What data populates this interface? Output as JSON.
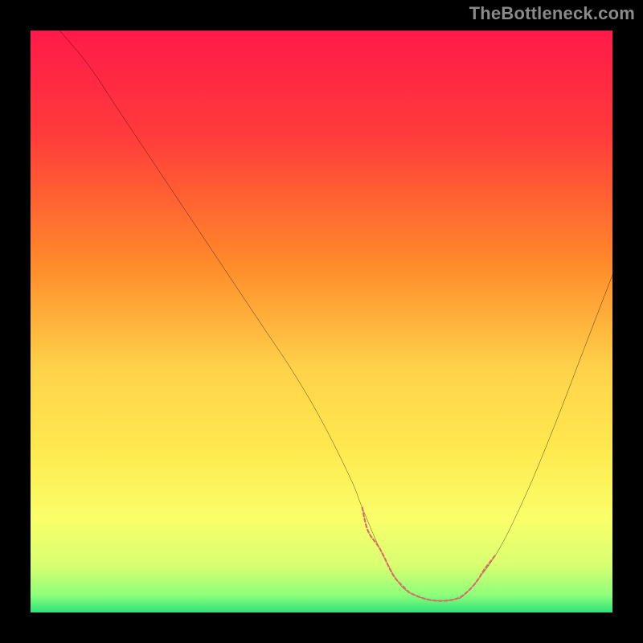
{
  "attribution": "TheBottleneck.com",
  "chart_data": {
    "type": "line",
    "title": "",
    "xlabel": "",
    "ylabel": "",
    "xlim": [
      0,
      100
    ],
    "ylim": [
      0,
      100
    ],
    "gradient_stops": [
      {
        "offset": 0,
        "color": "#ff1a49"
      },
      {
        "offset": 18,
        "color": "#ff3b3b"
      },
      {
        "offset": 40,
        "color": "#ff8a2a"
      },
      {
        "offset": 58,
        "color": "#ffd24a"
      },
      {
        "offset": 72,
        "color": "#ffe94f"
      },
      {
        "offset": 84,
        "color": "#faff6a"
      },
      {
        "offset": 92,
        "color": "#d7ff70"
      },
      {
        "offset": 97,
        "color": "#8dff7a"
      },
      {
        "offset": 100,
        "color": "#2fe27a"
      }
    ],
    "series": [
      {
        "name": "curve",
        "x": [
          5,
          10,
          15,
          20,
          25,
          30,
          35,
          40,
          45,
          50,
          55,
          57,
          60,
          63,
          65,
          68,
          70,
          73,
          75,
          80,
          85,
          90,
          95,
          100
        ],
        "values": [
          100,
          94,
          86.5,
          79,
          71.5,
          64,
          56.5,
          49,
          41.5,
          33,
          23,
          18,
          11,
          5.5,
          3.5,
          2.3,
          2.0,
          2.3,
          3.5,
          10,
          20,
          32,
          45,
          58
        ]
      },
      {
        "name": "highlight",
        "color": "#e06a6a",
        "x": [
          57,
          58,
          60,
          62,
          63,
          64,
          65,
          66,
          67,
          68,
          69,
          70,
          71,
          72,
          73,
          74,
          75,
          76,
          77,
          78,
          80
        ],
        "values": [
          18,
          14,
          11,
          7,
          5.5,
          4.5,
          3.5,
          3.0,
          2.6,
          2.3,
          2.1,
          2.0,
          2.0,
          2.1,
          2.3,
          2.7,
          3.5,
          4.5,
          5.8,
          7.4,
          10
        ]
      }
    ]
  }
}
